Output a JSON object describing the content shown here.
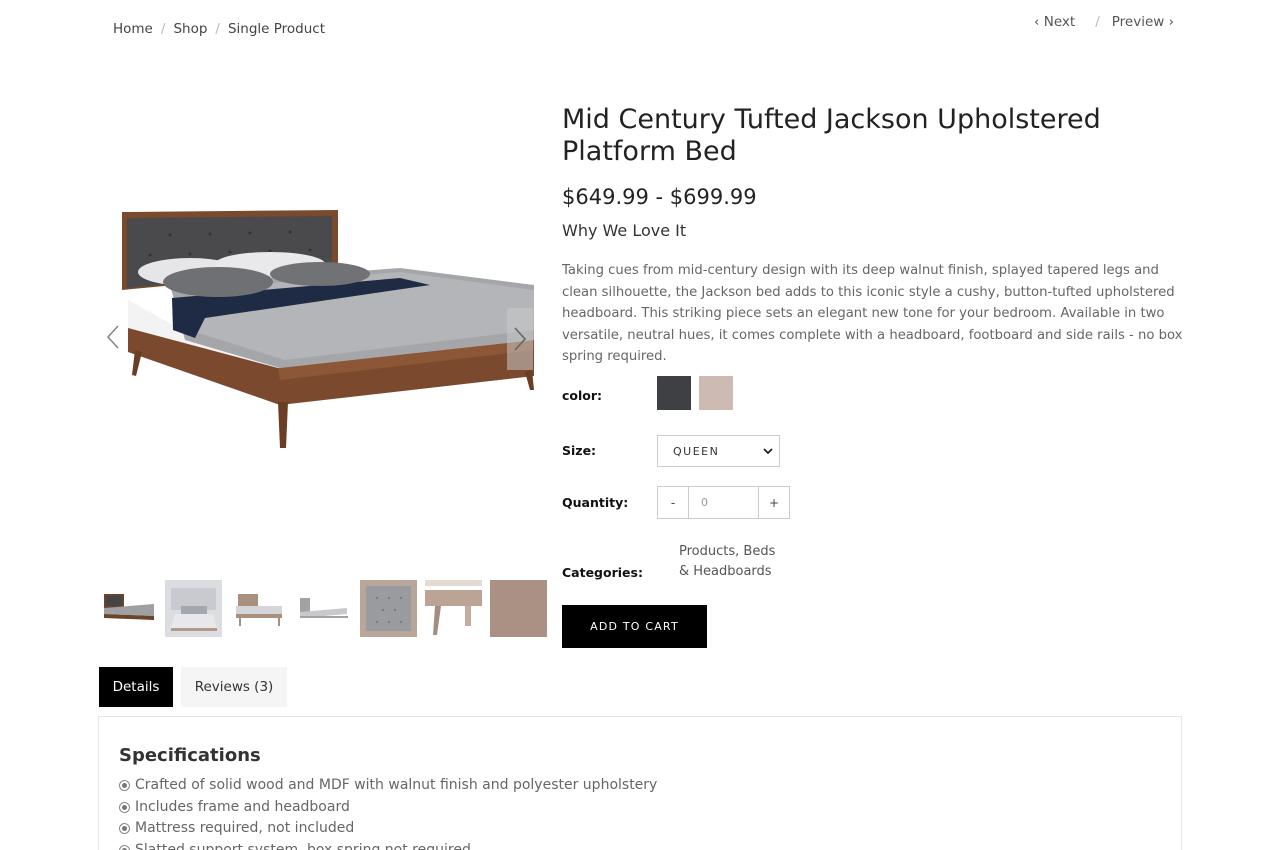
{
  "breadcrumb": {
    "items": [
      "Home",
      "Shop",
      "Single Product"
    ],
    "separator": "/"
  },
  "pager": {
    "next": "‹ Next",
    "separator": "/",
    "preview": "Preview ›"
  },
  "product": {
    "title": "Mid Century Tufted Jackson Upholstered Platform Bed",
    "price": "$649.99 - $699.99",
    "why_heading": "Why We Love It",
    "description": "Taking cues from mid-century design with its deep walnut finish, splayed tapered legs and clean silhouette, the Jackson bed adds to this iconic style a cushy, button-tufted upholstered headboard. This striking piece sets an elegant new tone for your bedroom. Available in two versatile, neutral hues, it comes complete with a headboard, footboard and side rails - no box spring required."
  },
  "options": {
    "color_label": "color:",
    "colors": [
      "#3f4043",
      "#cdbab3"
    ],
    "size_label": "Size:",
    "size_value": "QUEEN",
    "quantity_label": "Quantity:",
    "quantity_minus": "-",
    "quantity_value": "0",
    "quantity_plus": "+",
    "categories_label": "Categories:",
    "categories_value": "Products, Beds & Headboards"
  },
  "cart_button": "ADD TO CART",
  "tabs": [
    {
      "label": "Details",
      "active": true
    },
    {
      "label": "Reviews (3)",
      "active": false
    }
  ],
  "specifications": {
    "title": "Specifications",
    "items": [
      "Crafted of solid wood and MDF with walnut finish and polyester upholstery",
      "Includes frame and headboard",
      "Mattress required, not included",
      "Slatted support system, box spring not required"
    ]
  },
  "icons": {
    "gallery_prev": "chevron-left-icon",
    "gallery_next": "chevron-right-icon",
    "size_dropdown": "chevron-down-icon"
  }
}
